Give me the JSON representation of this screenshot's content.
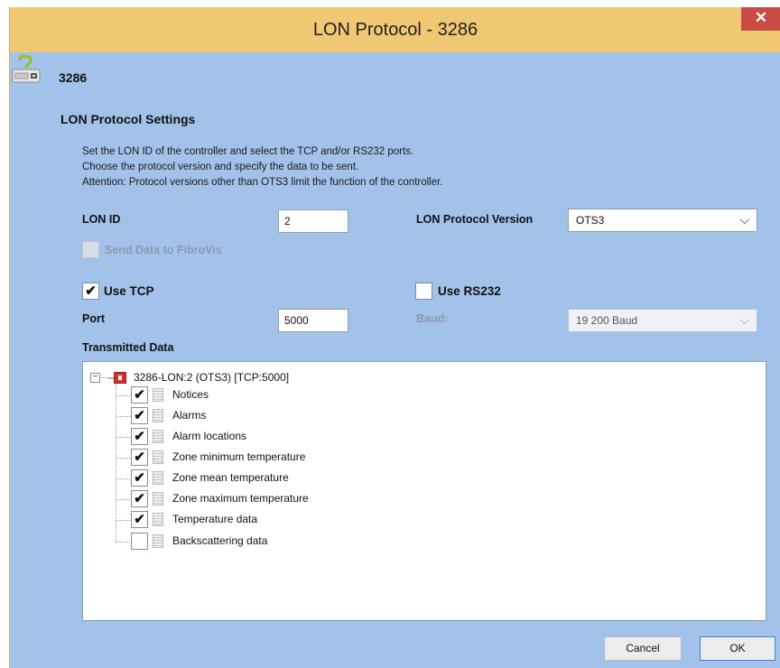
{
  "window": {
    "title": "LON Protocol - 3286",
    "close_glyph": "✕"
  },
  "header": {
    "device_name": "3286",
    "icon": "device-question-icon"
  },
  "settings": {
    "section_title": "LON Protocol Settings",
    "description": [
      "Set the LON ID of the controller and select the TCP and/or RS232 ports.",
      "Choose the protocol version and specify the data to be sent.",
      "Attention: Protocol versions other than OTS3 limit the function of the controller."
    ],
    "lon_id_label": "LON ID",
    "lon_id_value": "2",
    "version_label": "LON Protocol Version",
    "version_value": "OTS3",
    "fibrovis_label": "Send Data to FibroVis",
    "fibrovis_checked": false,
    "use_tcp_label": "Use TCP",
    "use_tcp_checked": true,
    "use_rs232_label": "Use RS232",
    "use_rs232_checked": false,
    "port_label": "Port",
    "port_value": "5000",
    "baud_label": "Baud:",
    "baud_value": "19 200 Baud"
  },
  "transmitted": {
    "label": "Transmitted Data",
    "root_label": "3286-LON:2 (OTS3) [TCP:5000]",
    "items": [
      {
        "label": "Notices",
        "checked": true
      },
      {
        "label": "Alarms",
        "checked": true
      },
      {
        "label": "Alarm locations",
        "checked": true
      },
      {
        "label": "Zone minimum temperature",
        "checked": true
      },
      {
        "label": "Zone mean temperature",
        "checked": true
      },
      {
        "label": "Zone maximum temperature",
        "checked": true
      },
      {
        "label": "Temperature data",
        "checked": true
      },
      {
        "label": "Backscattering data",
        "checked": false
      }
    ]
  },
  "footer": {
    "cancel_label": "Cancel",
    "ok_label": "OK"
  },
  "colors": {
    "titlebar": "#f0c873",
    "body": "#a3c2ea",
    "close": "#c94b43",
    "root_node": "#d43030"
  },
  "glyphs": {
    "check": "✔",
    "chevron": "⌵",
    "collapse": "−"
  }
}
